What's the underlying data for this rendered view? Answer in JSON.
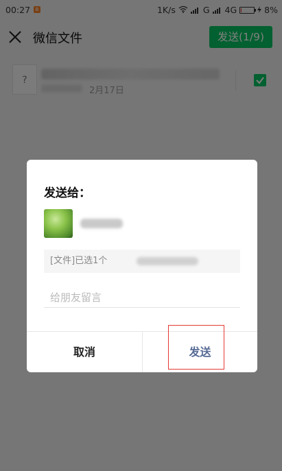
{
  "status_bar": {
    "time": "00:27",
    "notification_badge": "B",
    "network_speed": "1K/s",
    "signal_label_1": "G",
    "signal_label_2": "4G",
    "battery_percent": "8%",
    "battery_level": 0.08,
    "icons": [
      "wifi-icon",
      "signal-icon",
      "battery-icon",
      "charging-icon"
    ]
  },
  "header": {
    "title": "微信文件",
    "send_button": "发送(1/9)",
    "close_icon": "close-icon"
  },
  "file_list": {
    "items": [
      {
        "icon_glyph": "?",
        "meta": "2月17日",
        "selected": true
      }
    ]
  },
  "dialog": {
    "title": "发送给：",
    "file_summary": "[文件]已选1个",
    "message_placeholder": "给朋友留言",
    "cancel_label": "取消",
    "send_label": "发送"
  },
  "colors": {
    "accent_green": "#07c160",
    "link_blue": "#576b95",
    "highlight_red": "#e53935"
  }
}
